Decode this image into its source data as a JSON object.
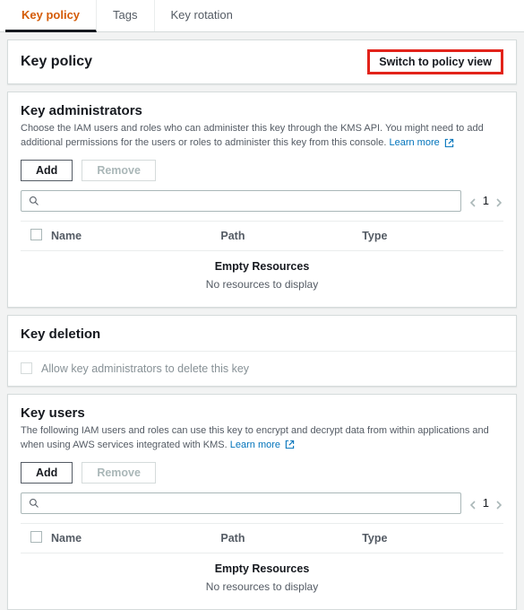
{
  "tabs": {
    "keyPolicy": "Key policy",
    "tags": "Tags",
    "keyRotation": "Key rotation"
  },
  "header": {
    "title": "Key policy",
    "switchButton": "Switch to policy view"
  },
  "admins": {
    "title": "Key administrators",
    "desc": "Choose the IAM users and roles who can administer this key through the KMS API. You might need to add additional permissions for the users or roles to administer this key from this console.",
    "learnMore": "Learn more",
    "addLabel": "Add",
    "removeLabel": "Remove",
    "page": "1",
    "cols": {
      "name": "Name",
      "path": "Path",
      "type": "Type"
    },
    "emptyTitle": "Empty Resources",
    "emptySub": "No resources to display"
  },
  "deletion": {
    "title": "Key deletion",
    "checkboxLabel": "Allow key administrators to delete this key"
  },
  "users": {
    "title": "Key users",
    "desc": "The following IAM users and roles can use this key to encrypt and decrypt data from within applications and when using AWS services integrated with KMS.",
    "learnMore": "Learn more",
    "addLabel": "Add",
    "removeLabel": "Remove",
    "page": "1",
    "cols": {
      "name": "Name",
      "path": "Path",
      "type": "Type"
    },
    "emptyTitle": "Empty Resources",
    "emptySub": "No resources to display"
  }
}
